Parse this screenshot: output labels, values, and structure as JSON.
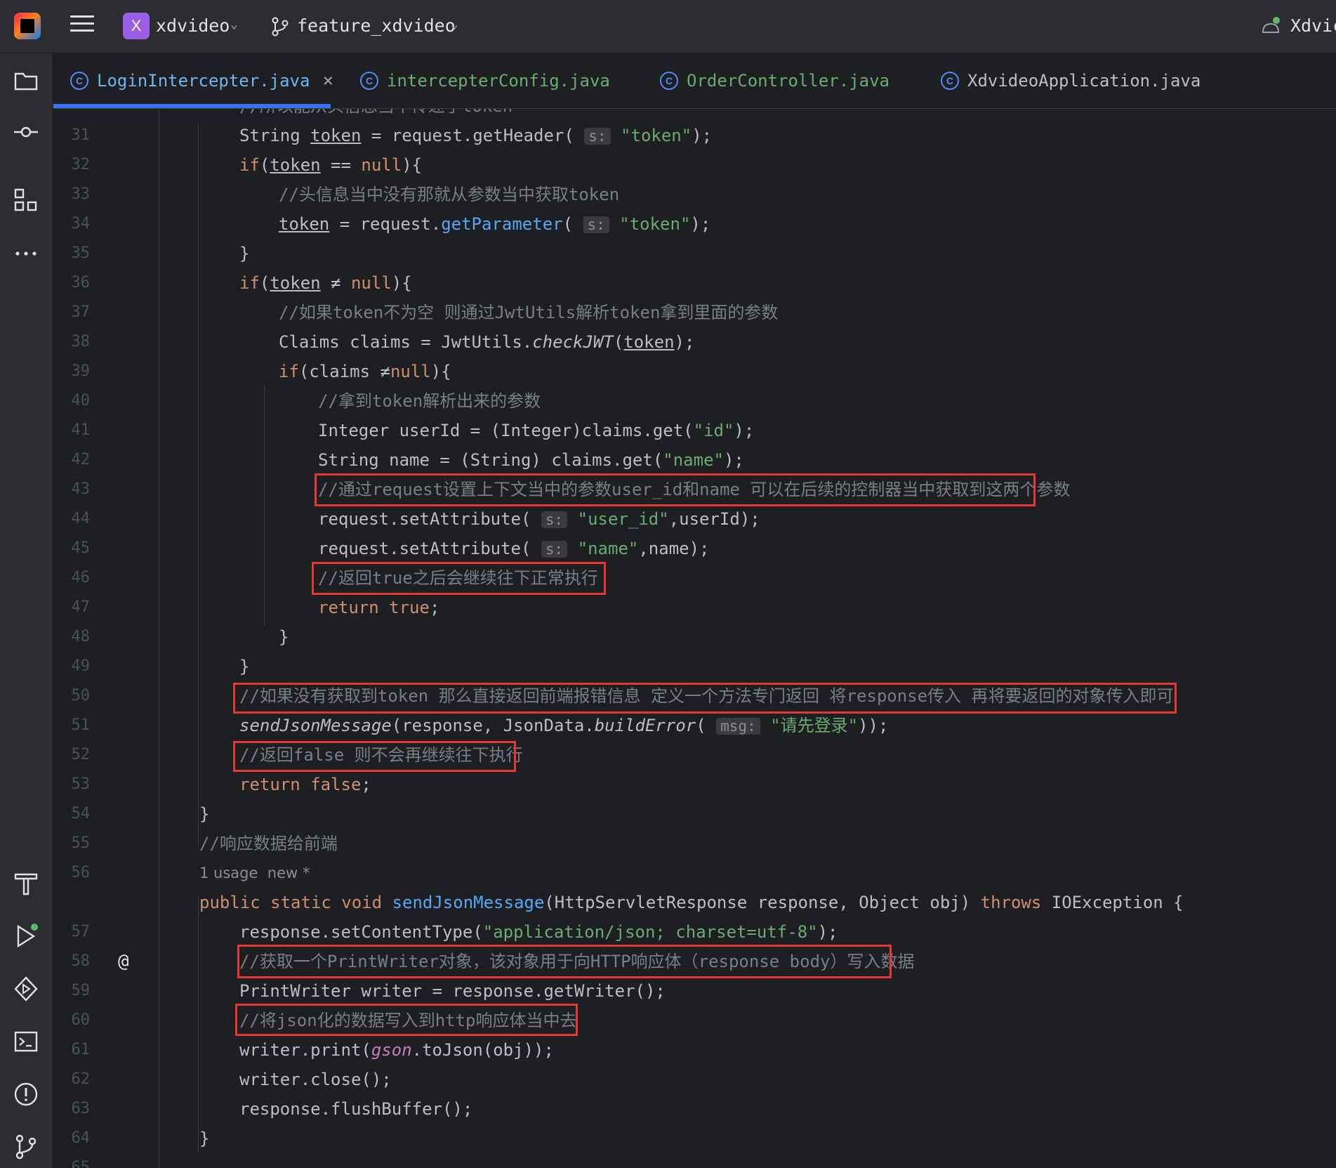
{
  "titlebar": {
    "project_initial": "X",
    "project_name": "xdvideo",
    "branch_name": "feature_xdvideo",
    "run_config": "Xdvic"
  },
  "tabs": [
    {
      "label": "LoginIntercepter.java",
      "active": true
    },
    {
      "label": "intercepterConfig.java",
      "active": false
    },
    {
      "label": "OrderController.java",
      "active": false
    },
    {
      "label": "XdvideoApplication.java",
      "active": false
    }
  ],
  "editor": {
    "lines": {
      "31": "//所以能从头信息当中传递了token",
      "32": {
        "n": "32"
      },
      "33": {
        "n": "33"
      },
      "34": {
        "n": "34",
        "comment": "//头信息当中没有那就从参数当中获取token"
      },
      "35": {
        "n": "35"
      },
      "36": {
        "n": "36"
      },
      "37": {
        "n": "37"
      },
      "38": {
        "n": "38",
        "comment": "//如果token不为空 则通过JwtUtils解析token拿到里面的参数"
      },
      "39": {
        "n": "39"
      },
      "40": {
        "n": "40"
      },
      "41": {
        "n": "41",
        "comment": "//拿到token解析出来的参数"
      },
      "42": {
        "n": "42"
      },
      "43": {
        "n": "43"
      },
      "44": {
        "n": "44",
        "comment": "//通过request设置上下文当中的参数user_id和name 可以在后续的控制器当中获取到这两个参数"
      },
      "45": {
        "n": "45"
      },
      "46": {
        "n": "46"
      },
      "47": {
        "n": "47",
        "comment": "//返回true之后会继续往下正常执行"
      },
      "48": {
        "n": "48"
      },
      "49": {
        "n": "49"
      },
      "50": {
        "n": "50"
      },
      "51": {
        "n": "51",
        "comment": "//如果没有获取到token 那么直接返回前端报错信息 定义一个方法专门返回 将response传入 再将要返回的对象传入即可"
      },
      "52": {
        "n": "52"
      },
      "53": {
        "n": "53",
        "comment": "//返回false 则不会再继续往下执行"
      },
      "54": {
        "n": "54"
      },
      "55": {
        "n": "55"
      },
      "56": {
        "n": "56",
        "comment": "//响应数据给前端"
      },
      "usage": "1 usage  new *",
      "57": {
        "n": "57"
      },
      "58": {
        "n": "58"
      },
      "59": {
        "n": "59",
        "comment": "//获取一个PrintWriter对象，该对象用于向HTTP响应体（response body）写入数据"
      },
      "60": {
        "n": "60"
      },
      "61": {
        "n": "61",
        "comment": "//将json化的数据写入到http响应体当中去"
      },
      "62": {
        "n": "62"
      },
      "63": {
        "n": "63"
      },
      "64": {
        "n": "64"
      },
      "65": {
        "n": "65"
      }
    },
    "strings": {
      "token": "\"token\"",
      "id": "\"id\"",
      "name": "\"name\"",
      "user_id": "\"user_id\"",
      "login_msg": "\"请先登录\"",
      "content_type": "\"application/json; charset=utf-8\""
    },
    "hints": {
      "s": "s:",
      "msg": "msg:"
    }
  }
}
